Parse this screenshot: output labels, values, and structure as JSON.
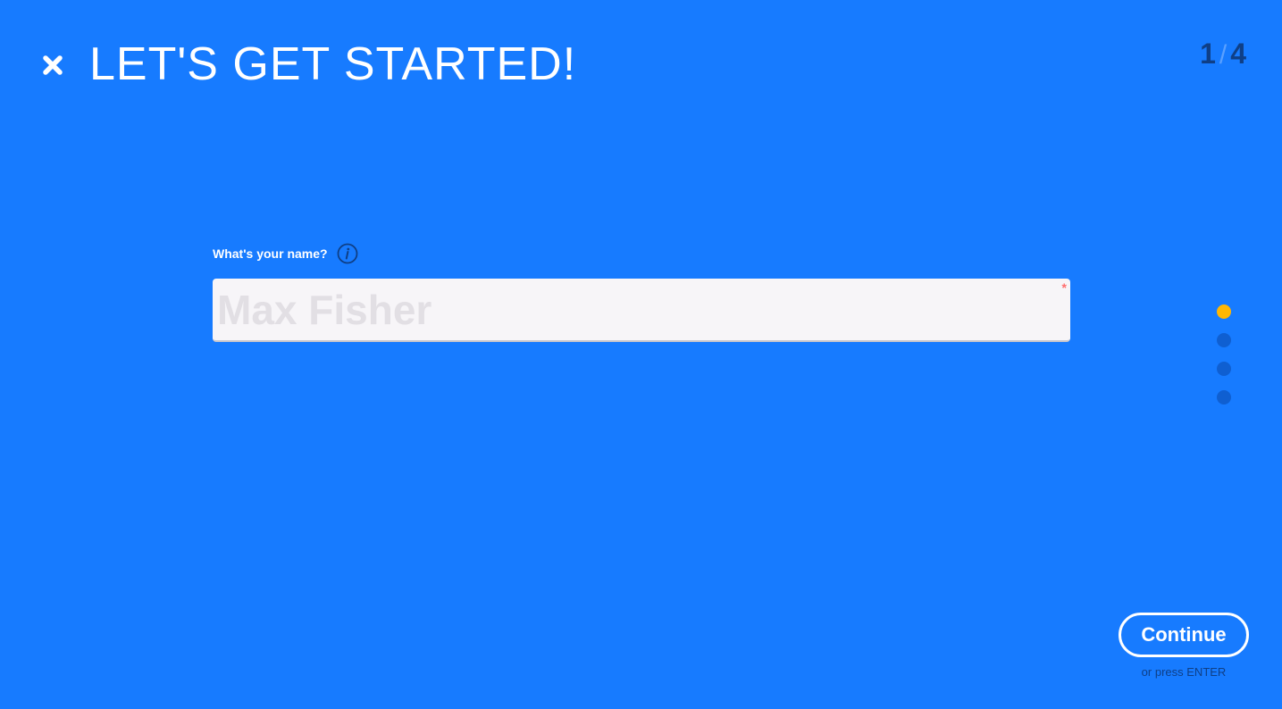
{
  "header": {
    "title": "LET'S GET STARTED!",
    "close_icon": "close-icon"
  },
  "progress": {
    "current": "1",
    "separator": "/",
    "total": "4"
  },
  "question": {
    "label": "What's your name?",
    "info_icon": "info-circle-icon"
  },
  "name_field": {
    "value": "",
    "placeholder": "Max Fisher",
    "required_mark": "*"
  },
  "steps": {
    "count": 4,
    "active_index": 0,
    "active_color": "#ffb703",
    "inactive_color": "#0f5fd1"
  },
  "footer": {
    "continue_label": "Continue",
    "hint_prefix": "or press",
    "hint_key": "ENTER"
  },
  "colors": {
    "background": "#177bff",
    "accent": "#ffb703",
    "text_dark": "#0f3f86",
    "required": "#ff6e6e"
  }
}
